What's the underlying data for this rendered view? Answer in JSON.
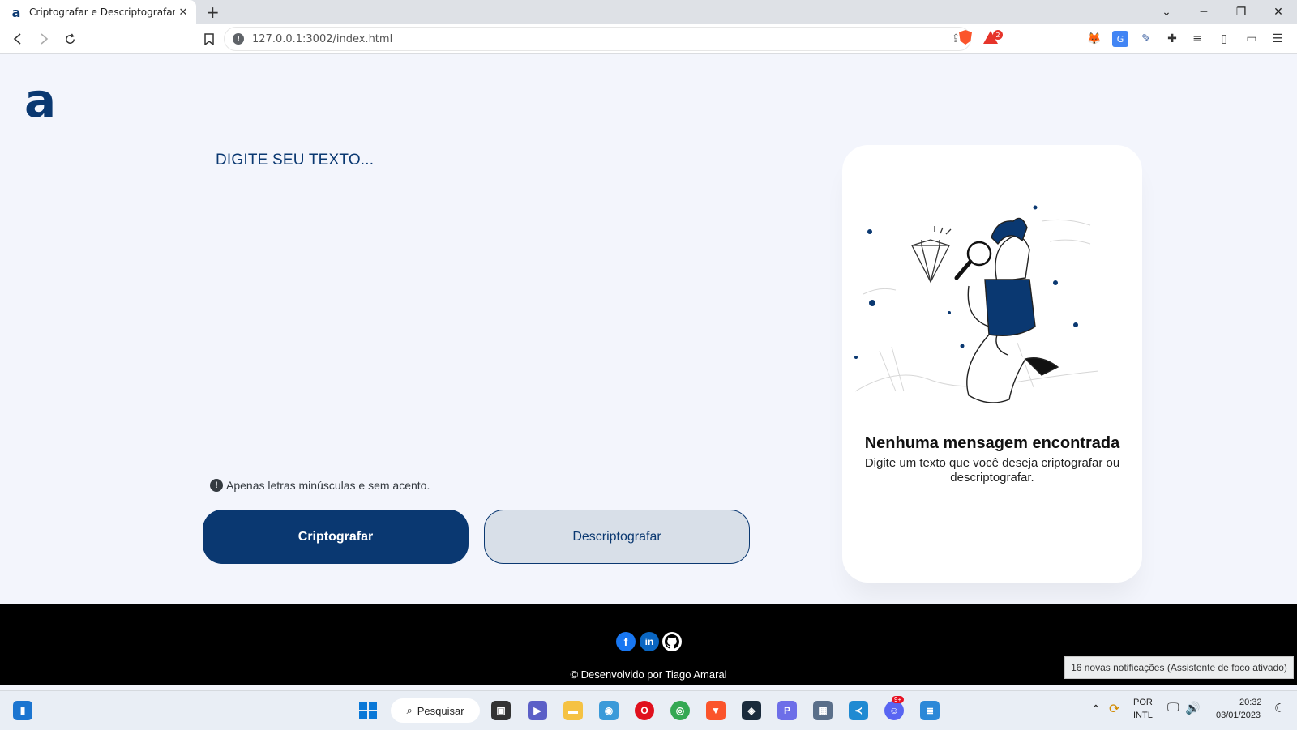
{
  "browser": {
    "tab_title": "Criptografar e Descriptografar",
    "favicon_letter": "a",
    "url": "127.0.0.1:3002/index.html",
    "brave_badge": "2"
  },
  "page": {
    "logo": "a",
    "textarea_placeholder": "DIGITE SEU TEXTO...",
    "hint": "Apenas letras minúsculas e sem acento.",
    "encrypt_button": "Criptografar",
    "decrypt_button": "Descriptografar",
    "output": {
      "title": "Nenhuma mensagem encontrada",
      "text": "Digite um texto que você deseja criptografar ou descriptografar."
    }
  },
  "footer": {
    "credit": "© Desenvolvido por Tiago Amaral",
    "social": [
      "facebook-icon",
      "linkedin-icon",
      "github-icon"
    ]
  },
  "notification": "16 novas notificações (Assistente de foco ativado)",
  "taskbar": {
    "search_label": "Pesquisar",
    "language": "POR",
    "keyboard": "INTL",
    "time": "20:32",
    "date": "03/01/2023",
    "discord_badge": "9+"
  },
  "colors": {
    "primary": "#0a3871",
    "page_bg": "#f3f5fc",
    "secondary_btn_bg": "#d8dfe8",
    "footer_bg": "#000000"
  }
}
